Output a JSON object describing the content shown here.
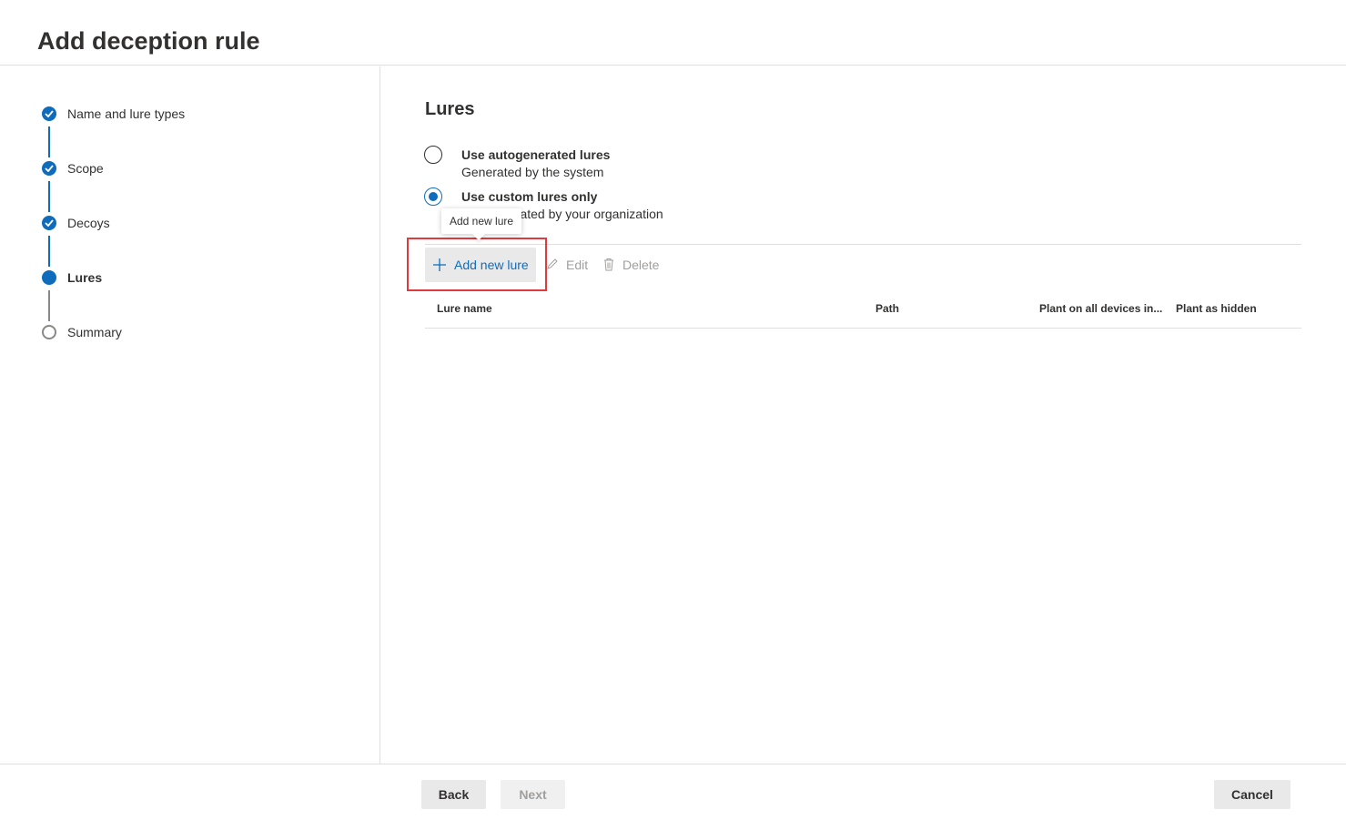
{
  "header": {
    "title": "Add deception rule"
  },
  "wizard": {
    "steps": [
      {
        "label": "Name and lure types",
        "state": "completed"
      },
      {
        "label": "Scope",
        "state": "completed"
      },
      {
        "label": "Decoys",
        "state": "completed"
      },
      {
        "label": "Lures",
        "state": "current"
      },
      {
        "label": "Summary",
        "state": "not-started"
      }
    ]
  },
  "main": {
    "section_title": "Lures",
    "options": [
      {
        "label": "Use autogenerated lures",
        "description": "Generated by the system",
        "selected": false
      },
      {
        "label": "Use custom lures only",
        "description": "created by your organization",
        "selected": true
      }
    ],
    "toolbar": {
      "add_label": "Add new lure",
      "add_tooltip": "Add new lure",
      "edit_label": "Edit",
      "delete_label": "Delete"
    },
    "table": {
      "columns": [
        "Lure name",
        "Path",
        "Plant on all devices in...",
        "Plant as hidden"
      ],
      "rows": []
    }
  },
  "footer": {
    "back_label": "Back",
    "next_label": "Next",
    "cancel_label": "Cancel"
  },
  "colors": {
    "accent": "#0f6cbd",
    "highlight": "#e0393e",
    "disabled_text": "#a19f9d"
  }
}
